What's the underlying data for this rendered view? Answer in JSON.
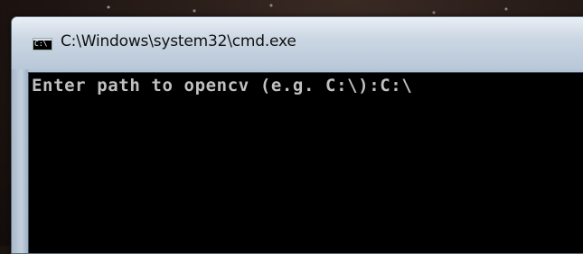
{
  "window": {
    "title": "C:\\Windows\\system32\\cmd.exe",
    "icon": "cmd-icon",
    "icon_glyph": "C:\\"
  },
  "console": {
    "line": "Enter path to opencv (e.g. C:\\):C:\\"
  },
  "colors": {
    "console_background": "#000000",
    "console_text": "#c0c0c0"
  }
}
